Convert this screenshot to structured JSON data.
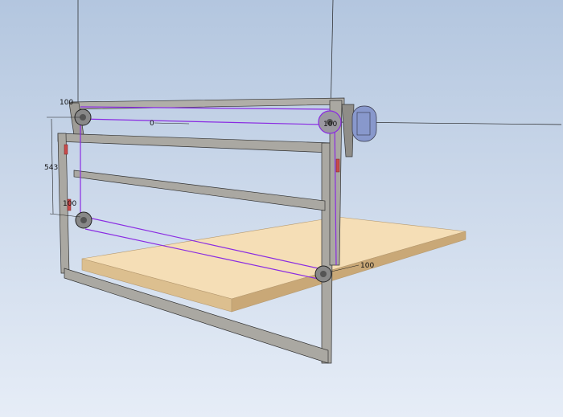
{
  "viewport": {
    "dimensions": {
      "top_left_pulley": "100",
      "center_offset": "0",
      "right_pulley": "100",
      "vertical_distance": "543",
      "lower_left_pulley": "100",
      "lower_right_pulley": "100"
    },
    "colors": {
      "frame": "#a8a6a0",
      "belt": "#8a2be2",
      "board": "#f2d9b0",
      "motor": "#7f8fc8",
      "clamp": "#c84a4a"
    }
  }
}
